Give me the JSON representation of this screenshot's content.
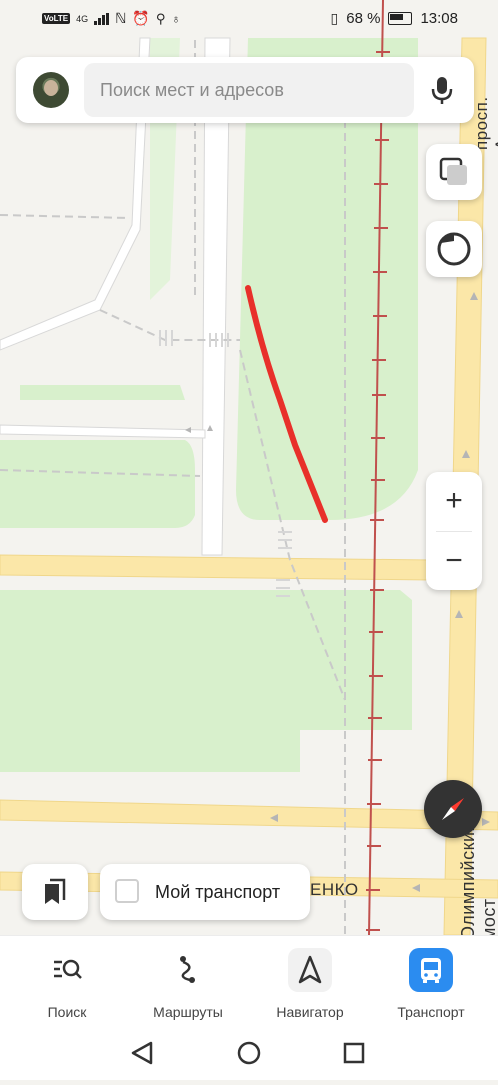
{
  "status_bar": {
    "network_badge": "VoLTE",
    "network_type": "4G",
    "battery_percent": "68 %",
    "time": "13:08"
  },
  "search": {
    "placeholder": "Поиск мест и адресов",
    "mic_icon": "microphone-icon",
    "avatar_icon": "user-avatar"
  },
  "map": {
    "labels": {
      "street_top_right": "просп. Алек",
      "bridge": "Олимпийский мост",
      "street_bottom": "енко"
    },
    "colors": {
      "land": "#f4f3ef",
      "park": "#d8f0cc",
      "road": "#fbe7a8",
      "rail": "#c0504d",
      "drawn_stroke": "#e8302a"
    }
  },
  "controls": {
    "layers_icon": "layers-icon",
    "locate_icon": "location-icon",
    "zoom_in": "+",
    "zoom_out": "−",
    "compass_icon": "compass-icon",
    "bookmarks_icon": "bookmarks-icon",
    "my_transport_label": "Мой транспорт"
  },
  "bottom_nav": {
    "tabs": [
      {
        "label": "Поиск",
        "icon": "search-list-icon"
      },
      {
        "label": "Маршруты",
        "icon": "route-icon"
      },
      {
        "label": "Навигатор",
        "icon": "navigator-arrow-icon"
      },
      {
        "label": "Транспорт",
        "icon": "bus-icon",
        "active": true
      }
    ]
  },
  "system_nav": {
    "back_icon": "back-icon",
    "home_icon": "home-icon",
    "recents_icon": "recents-icon"
  }
}
